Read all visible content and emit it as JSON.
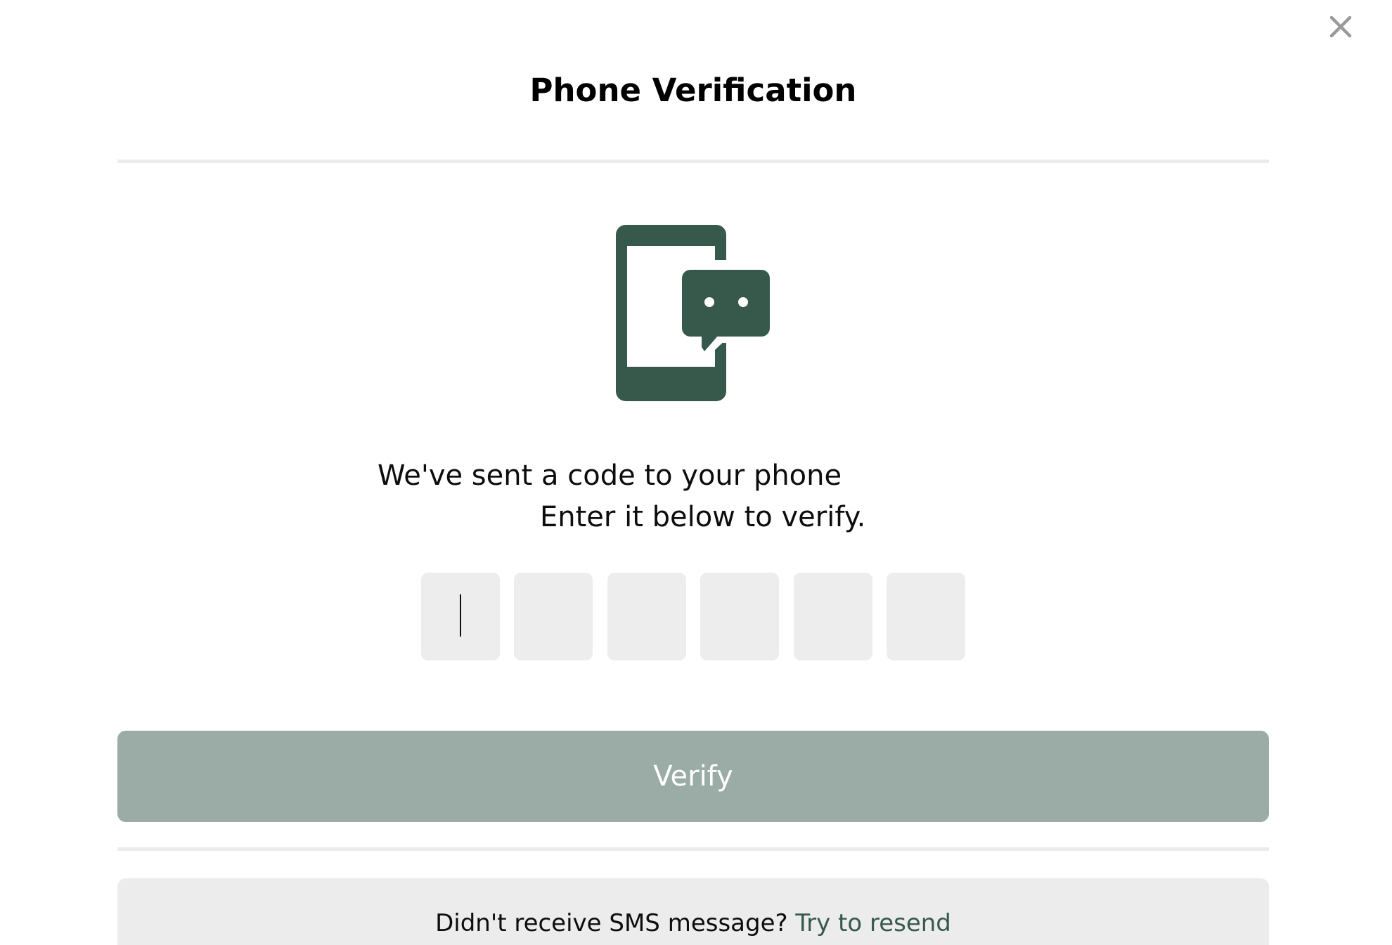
{
  "dialog": {
    "title": "Phone Verification",
    "icon": "phone-message-icon",
    "close_icon": "close-icon",
    "message_line_1": "We've sent a code to your phone",
    "message_line_2": "Enter it below to verify.",
    "code": {
      "digits": [
        "",
        "",
        "",
        "",
        "",
        ""
      ],
      "focused_index": 0
    },
    "verify_label": "Verify",
    "resend_prompt": "Didn't receive SMS message?",
    "resend_link": "Try to resend"
  },
  "colors": {
    "brand_green": "#36594b",
    "verify_disabled": "#9aaca5",
    "cell_background": "#ededed",
    "panel_background": "#ececec",
    "close_icon": "#9a9a9a"
  }
}
